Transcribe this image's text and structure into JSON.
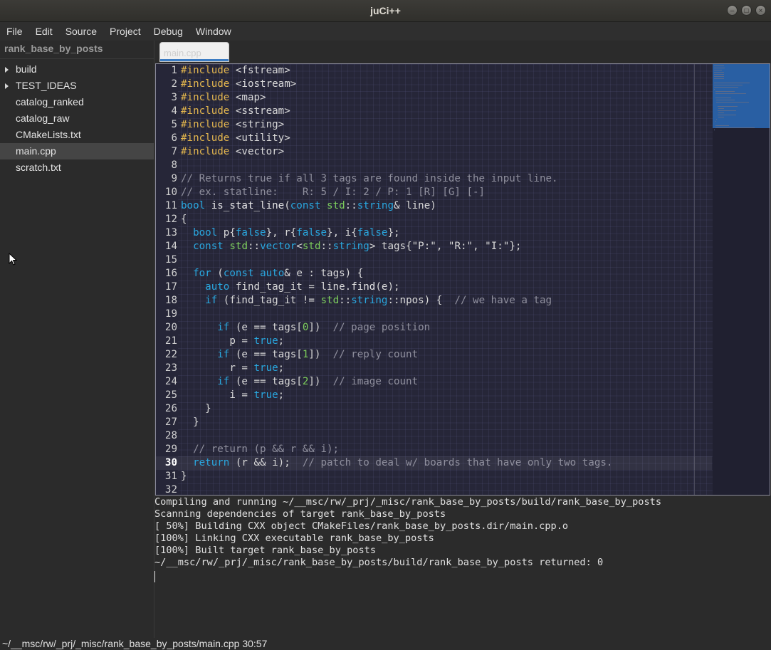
{
  "window": {
    "title": "juCi++"
  },
  "menu": [
    "File",
    "Edit",
    "Source",
    "Project",
    "Debug",
    "Window"
  ],
  "sidebar": {
    "project_name": "rank_base_by_posts",
    "items": [
      {
        "label": "build",
        "folder": true
      },
      {
        "label": "TEST_IDEAS",
        "folder": true
      },
      {
        "label": "catalog_ranked",
        "folder": false
      },
      {
        "label": "catalog_raw",
        "folder": false
      },
      {
        "label": "CMakeLists.txt",
        "folder": false
      },
      {
        "label": "main.cpp",
        "folder": false,
        "selected": true
      },
      {
        "label": "scratch.txt",
        "folder": false
      }
    ]
  },
  "tabs": [
    {
      "label": "main.cpp",
      "active": true
    }
  ],
  "editor": {
    "current_line": 30,
    "lines": [
      {
        "n": "1",
        "t": [
          [
            "pre",
            "#include"
          ],
          [
            "inc",
            " <fstream>"
          ]
        ]
      },
      {
        "n": "2",
        "t": [
          [
            "pre",
            "#include"
          ],
          [
            "inc",
            " <iostream>"
          ]
        ]
      },
      {
        "n": "3",
        "t": [
          [
            "pre",
            "#include"
          ],
          [
            "inc",
            " <map>"
          ]
        ]
      },
      {
        "n": "4",
        "t": [
          [
            "pre",
            "#include"
          ],
          [
            "inc",
            " <sstream>"
          ]
        ]
      },
      {
        "n": "5",
        "t": [
          [
            "pre",
            "#include"
          ],
          [
            "inc",
            " <string>"
          ]
        ]
      },
      {
        "n": "6",
        "t": [
          [
            "pre",
            "#include"
          ],
          [
            "inc",
            " <utility>"
          ]
        ]
      },
      {
        "n": "7",
        "t": [
          [
            "pre",
            "#include"
          ],
          [
            "inc",
            " <vector>"
          ]
        ]
      },
      {
        "n": "8",
        "t": []
      },
      {
        "n": "9",
        "t": [
          [
            "com",
            "// Returns true if all 3 tags are found inside the input line."
          ]
        ]
      },
      {
        "n": "10",
        "t": [
          [
            "com",
            "// ex. statline:    R: 5 / I: 2 / P: 1 [R] [G] [-]"
          ]
        ]
      },
      {
        "n": "11",
        "t": [
          [
            "kw",
            "bool"
          ],
          [
            "txt",
            " "
          ],
          [
            "fn",
            "is_stat_line"
          ],
          [
            "txt",
            "("
          ],
          [
            "kw",
            "const"
          ],
          [
            "txt",
            " "
          ],
          [
            "ty",
            "std"
          ],
          [
            "txt",
            "::"
          ],
          [
            "kw",
            "string"
          ],
          [
            "txt",
            "& line)"
          ]
        ]
      },
      {
        "n": "12",
        "t": [
          [
            "txt",
            "{"
          ]
        ]
      },
      {
        "n": "13",
        "t": [
          [
            "txt",
            "  "
          ],
          [
            "kw",
            "bool"
          ],
          [
            "txt",
            " p{"
          ],
          [
            "kw",
            "false"
          ],
          [
            "txt",
            "}, r{"
          ],
          [
            "kw",
            "false"
          ],
          [
            "txt",
            "}, i{"
          ],
          [
            "kw",
            "false"
          ],
          [
            "txt",
            "};"
          ]
        ]
      },
      {
        "n": "14",
        "t": [
          [
            "txt",
            "  "
          ],
          [
            "kw",
            "const"
          ],
          [
            "txt",
            " "
          ],
          [
            "ty",
            "std"
          ],
          [
            "txt",
            "::"
          ],
          [
            "kw",
            "vector"
          ],
          [
            "txt",
            "<"
          ],
          [
            "ty",
            "std"
          ],
          [
            "txt",
            "::"
          ],
          [
            "kw",
            "string"
          ],
          [
            "txt",
            "> tags{"
          ],
          [
            "str",
            "\"P:\""
          ],
          [
            "txt",
            ", "
          ],
          [
            "str",
            "\"R:\""
          ],
          [
            "txt",
            ", "
          ],
          [
            "str",
            "\"I:\""
          ],
          [
            "txt",
            "};"
          ]
        ]
      },
      {
        "n": "15",
        "t": []
      },
      {
        "n": "16",
        "t": [
          [
            "txt",
            "  "
          ],
          [
            "kw",
            "for"
          ],
          [
            "txt",
            " ("
          ],
          [
            "kw",
            "const"
          ],
          [
            "txt",
            " "
          ],
          [
            "kw",
            "auto"
          ],
          [
            "txt",
            "& e : tags) {"
          ]
        ]
      },
      {
        "n": "17",
        "t": [
          [
            "txt",
            "    "
          ],
          [
            "kw",
            "auto"
          ],
          [
            "txt",
            " find_tag_it = line."
          ],
          [
            "fn",
            "find"
          ],
          [
            "txt",
            "(e);"
          ]
        ]
      },
      {
        "n": "18",
        "t": [
          [
            "txt",
            "    "
          ],
          [
            "kw",
            "if"
          ],
          [
            "txt",
            " (find_tag_it != "
          ],
          [
            "ty",
            "std"
          ],
          [
            "txt",
            "::"
          ],
          [
            "kw",
            "string"
          ],
          [
            "txt",
            "::npos) {  "
          ],
          [
            "com",
            "// we have a tag"
          ]
        ]
      },
      {
        "n": "19",
        "t": []
      },
      {
        "n": "20",
        "t": [
          [
            "txt",
            "      "
          ],
          [
            "kw",
            "if"
          ],
          [
            "txt",
            " (e == tags["
          ],
          [
            "ty",
            "0"
          ],
          [
            "txt",
            "])  "
          ],
          [
            "com",
            "// page position"
          ]
        ]
      },
      {
        "n": "21",
        "t": [
          [
            "txt",
            "        p = "
          ],
          [
            "kw",
            "true"
          ],
          [
            "txt",
            ";"
          ]
        ]
      },
      {
        "n": "22",
        "t": [
          [
            "txt",
            "      "
          ],
          [
            "kw",
            "if"
          ],
          [
            "txt",
            " (e == tags["
          ],
          [
            "ty",
            "1"
          ],
          [
            "txt",
            "])  "
          ],
          [
            "com",
            "// reply count"
          ]
        ]
      },
      {
        "n": "23",
        "t": [
          [
            "txt",
            "        r = "
          ],
          [
            "kw",
            "true"
          ],
          [
            "txt",
            ";"
          ]
        ]
      },
      {
        "n": "24",
        "t": [
          [
            "txt",
            "      "
          ],
          [
            "kw",
            "if"
          ],
          [
            "txt",
            " (e == tags["
          ],
          [
            "ty",
            "2"
          ],
          [
            "txt",
            "])  "
          ],
          [
            "com",
            "// image count"
          ]
        ]
      },
      {
        "n": "25",
        "t": [
          [
            "txt",
            "        i = "
          ],
          [
            "kw",
            "true"
          ],
          [
            "txt",
            ";"
          ]
        ]
      },
      {
        "n": "26",
        "t": [
          [
            "txt",
            "    }"
          ]
        ]
      },
      {
        "n": "27",
        "t": [
          [
            "txt",
            "  }"
          ]
        ]
      },
      {
        "n": "28",
        "t": []
      },
      {
        "n": "29",
        "t": [
          [
            "txt",
            "  "
          ],
          [
            "com",
            "// return (p && r && i);"
          ]
        ]
      },
      {
        "n": "30",
        "t": [
          [
            "txt",
            "  "
          ],
          [
            "kw",
            "return"
          ],
          [
            "txt",
            " (r && i);  "
          ],
          [
            "com",
            "// patch to deal w/ boards that have only two tags."
          ]
        ]
      },
      {
        "n": "31",
        "t": [
          [
            "txt",
            "}"
          ]
        ]
      },
      {
        "n": "32",
        "t": []
      }
    ]
  },
  "terminal": {
    "lines": [
      "Compiling and running ~/__msc/rw/_prj/_misc/rank_base_by_posts/build/rank_base_by_posts",
      "Scanning dependencies of target rank_base_by_posts",
      "[ 50%] Building CXX object CMakeFiles/rank_base_by_posts.dir/main.cpp.o",
      "[100%] Linking CXX executable rank_base_by_posts",
      "[100%] Built target rank_base_by_posts",
      "~/__msc/rw/_prj/_misc/rank_base_by_posts/build/rank_base_by_posts returned: 0"
    ]
  },
  "status": {
    "path": "~/__msc/rw/_prj/_misc/rank_base_by_posts/main.cpp",
    "position": "30:57"
  },
  "colors": {
    "keyword": "#29a7df",
    "preprocessor": "#e3b64e",
    "type": "#7ccd5c",
    "comment": "#8f8f9d",
    "editor_bg": "#262638",
    "accent": "#3c7cc3"
  }
}
